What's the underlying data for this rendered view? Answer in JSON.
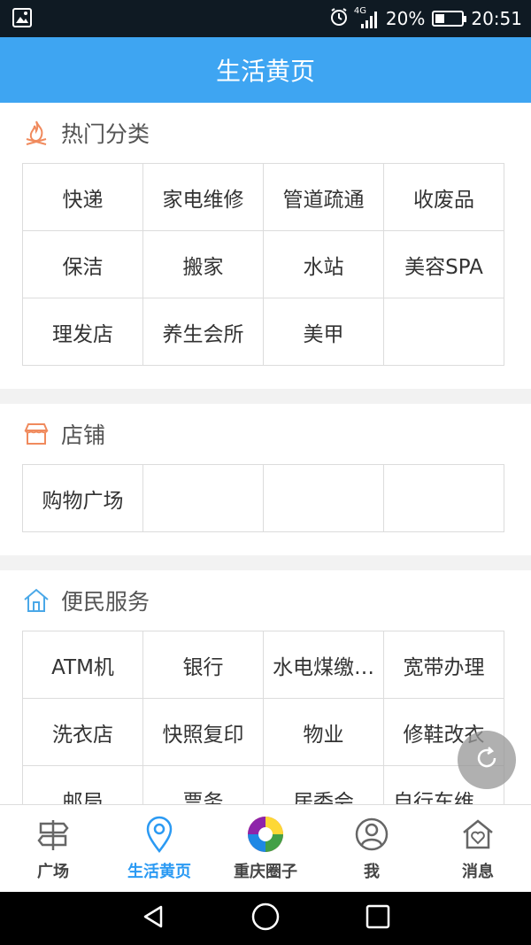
{
  "status": {
    "signal": "4G",
    "battery": "20%",
    "battery_level": 0.2,
    "time": "20:51"
  },
  "header": {
    "title": "生活黄页"
  },
  "sections": [
    {
      "title": "热门分类",
      "icon": "fire-icon",
      "items": [
        "快递",
        "家电维修",
        "管道疏通",
        "收废品",
        "保洁",
        "搬家",
        "水站",
        "美容SPA",
        "理发店",
        "养生会所",
        "美甲",
        ""
      ]
    },
    {
      "title": "店铺",
      "icon": "store-icon",
      "items": [
        "购物广场",
        "",
        "",
        ""
      ]
    },
    {
      "title": "便民服务",
      "icon": "house-icon",
      "items": [
        "ATM机",
        "银行",
        "水电煤缴…",
        "宽带办理",
        "洗衣店",
        "快照复印",
        "物业",
        "修鞋改衣",
        "邮局",
        "票务",
        "居委会",
        "自行车维…"
      ]
    }
  ],
  "tabs": [
    {
      "label": "广场",
      "icon": "signpost-icon"
    },
    {
      "label": "生活黄页",
      "icon": "location-pin-icon"
    },
    {
      "label": "重庆圈子",
      "icon": "camera-aperture-icon"
    },
    {
      "label": "我",
      "icon": "user-icon"
    },
    {
      "label": "消息",
      "icon": "heart-house-icon"
    }
  ],
  "colors": {
    "accent": "#3ea5f2",
    "active_tab": "#2b9af3",
    "section_icon": "#f08a5d"
  }
}
